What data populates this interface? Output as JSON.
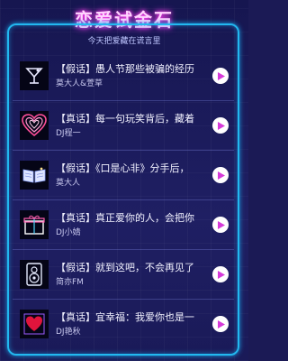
{
  "header": {
    "title": "恋爱试金石",
    "subtitle": "今天把爱藏在谎言里"
  },
  "colors": {
    "accent_pink": "#ff3cf0",
    "frame_blue": "#22b8f0",
    "play_icon": "#d63ad8"
  },
  "items": [
    {
      "icon": "cocktail-glass-icon",
      "title": "【假话】愚人节那些被骗的经历",
      "author": "莫大人&萱草"
    },
    {
      "icon": "neon-heart-icon",
      "title": "【真话】每一句玩笑背后，藏着",
      "author": "DJ程一"
    },
    {
      "icon": "open-book-icon",
      "title": "【假话】《口是心非》分手后，",
      "author": "莫大人"
    },
    {
      "icon": "gift-box-icon",
      "title": "【真话】真正爱你的人，会把你",
      "author": "DJ小婧"
    },
    {
      "icon": "speaker-icon",
      "title": "【假话】就到这吧，不会再见了",
      "author": "简亦FM"
    },
    {
      "icon": "heart-frame-icon",
      "title": "【真话】宜幸福：我爱你也是一",
      "author": "DJ艳秋"
    }
  ]
}
